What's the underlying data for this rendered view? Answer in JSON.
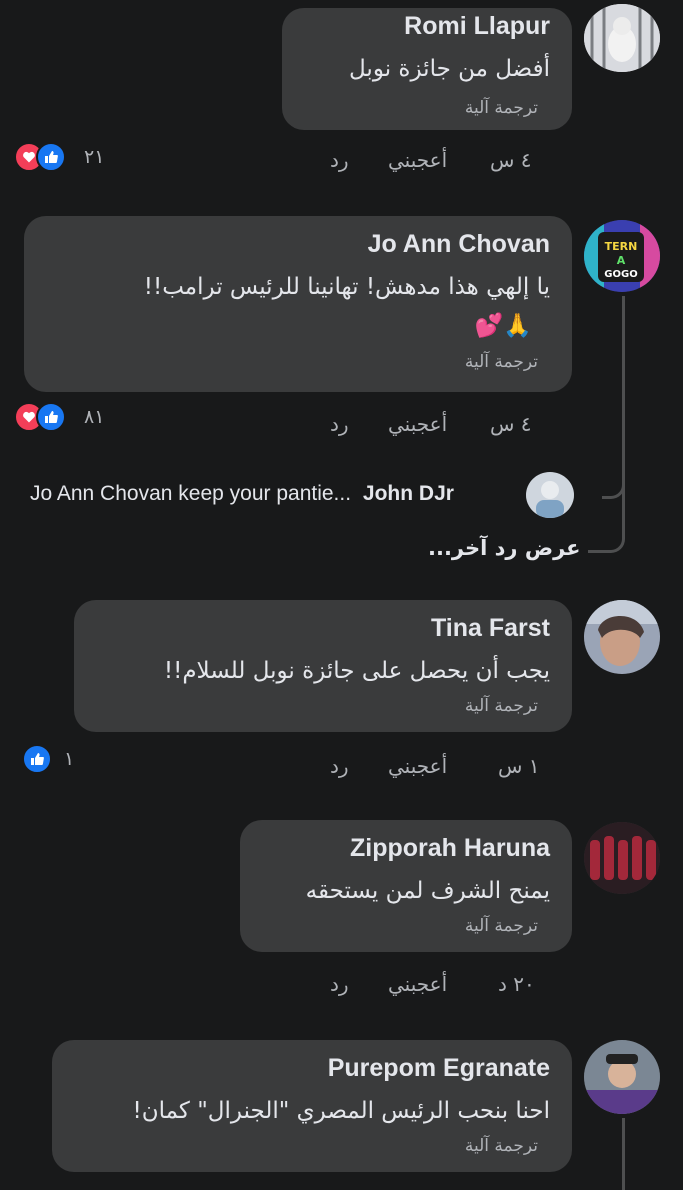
{
  "comments": [
    {
      "name": "Romi Llapur",
      "text": "أفضل من جائزة نوبل",
      "translate": "ترجمة آلية",
      "time": "٤ س",
      "like": "أعجبني",
      "reply": "رد",
      "reactions_count": "٢١",
      "reactions": [
        "like-icon",
        "love-icon"
      ]
    },
    {
      "name": "Jo Ann Chovan",
      "text": "يا إلهي هذا مدهش! تهانينا للرئيس ترامب!!",
      "emoji": "🙏💕",
      "translate": "ترجمة آلية",
      "time": "٤ س",
      "like": "أعجبني",
      "reply": "رد",
      "reactions_count": "٨١",
      "reactions": [
        "like-icon",
        "love-icon"
      ]
    },
    {
      "name": "Tina Farst",
      "text": "يجب أن يحصل على جائزة نوبل للسلام!!",
      "translate": "ترجمة آلية",
      "time": "١ س",
      "like": "أعجبني",
      "reply": "رد",
      "reactions_count": "١",
      "reactions": [
        "like-icon"
      ]
    },
    {
      "name": "Zipporah Haruna",
      "text": "يمنح الشرف لمن يستحقه",
      "translate": "ترجمة آلية",
      "time": "٢٠ د",
      "like": "أعجبني",
      "reply": "رد"
    },
    {
      "name": "Purepom Egranate",
      "text": "احنا بنحب الرئيس المصري \"الجنرال\" كمان!",
      "translate": "ترجمة آلية"
    }
  ],
  "reply_preview": {
    "name": "John DJr",
    "text": "Jo Ann Chovan keep your pantie..."
  },
  "more_replies": "عرض رد آخر...",
  "colors": {
    "background": "#18191a",
    "bubble": "#3a3b3c",
    "text": "#e4e6eb",
    "secondary": "#b0b3b8",
    "like": "#1877f2",
    "love": "#f33e58"
  }
}
